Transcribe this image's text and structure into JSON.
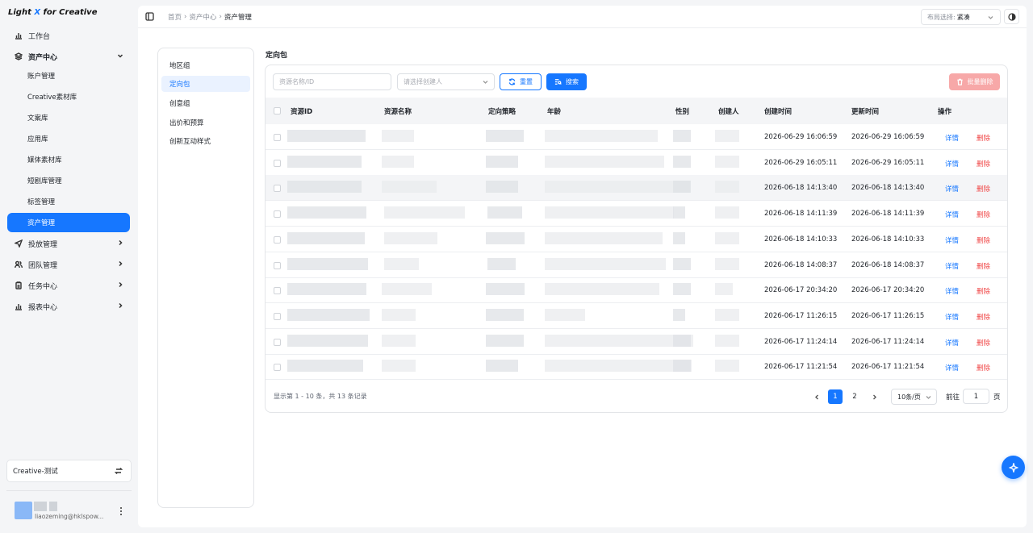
{
  "app": {
    "logo_a": "Light ",
    "logo_x": "X",
    "logo_b": " for Creative"
  },
  "sidebar": {
    "workbench": "工作台",
    "asset_center": "资产中心",
    "sub_items": [
      "账户管理",
      "Creative素材库",
      "文案库",
      "应用库",
      "媒体素材库",
      "短剧库管理",
      "标签管理",
      "资产管理"
    ],
    "delivery": "投放管理",
    "team": "团队管理",
    "tasks": "任务中心",
    "reports": "报表中心",
    "environment": "Creative-测试",
    "user_email": "liaozeming@hklspow..."
  },
  "topbar": {
    "breadcrumb": [
      "首页",
      "资产中心",
      "资产管理"
    ],
    "layout_label": "布局选择:",
    "layout_value": "紧凑"
  },
  "resource_nav": [
    "地区组",
    "定向包",
    "创意组",
    "出价和预算",
    "创新互动样式"
  ],
  "content": {
    "title": "定向包",
    "search_placeholder": "资源名称/ID",
    "creator_placeholder": "请选择创建人",
    "reset_label": "重置",
    "search_label": "搜索",
    "batch_delete_label": "批量删除"
  },
  "table": {
    "columns": [
      "资源ID",
      "资源名称",
      "定向策略",
      "年龄",
      "性别",
      "创建人",
      "创建时间",
      "更新时间",
      "操作"
    ],
    "rows": [
      {
        "created": "2026-06-29 16:06:59",
        "updated": "2026-06-29 16:06:59"
      },
      {
        "created": "2026-06-29 16:05:11",
        "updated": "2026-06-29 16:05:11"
      },
      {
        "created": "2026-06-18 14:13:40",
        "updated": "2026-06-18 14:13:40"
      },
      {
        "created": "2026-06-18 14:11:39",
        "updated": "2026-06-18 14:11:39"
      },
      {
        "created": "2026-06-18 14:10:33",
        "updated": "2026-06-18 14:10:33"
      },
      {
        "created": "2026-06-18 14:08:37",
        "updated": "2026-06-18 14:08:37"
      },
      {
        "created": "2026-06-17 20:34:20",
        "updated": "2026-06-17 20:34:20"
      },
      {
        "created": "2026-06-17 11:26:15",
        "updated": "2026-06-17 11:26:15"
      },
      {
        "created": "2026-06-17 11:24:14",
        "updated": "2026-06-17 11:24:14"
      },
      {
        "created": "2026-06-17 11:21:54",
        "updated": "2026-06-17 11:21:54"
      }
    ],
    "detail_label": "详情",
    "delete_label": "删除"
  },
  "pagination": {
    "summary": "显示第 1 - 10 条，共 13 条记录",
    "pages": [
      "1",
      "2"
    ],
    "current_page": "1",
    "page_size": "10条/页",
    "goto_label": "前往",
    "goto_value": "1",
    "goto_suffix": "页"
  },
  "colors": {
    "accent": "#1677ff",
    "danger": "#f04646",
    "sidebar_bg": "#f4f5f7"
  }
}
